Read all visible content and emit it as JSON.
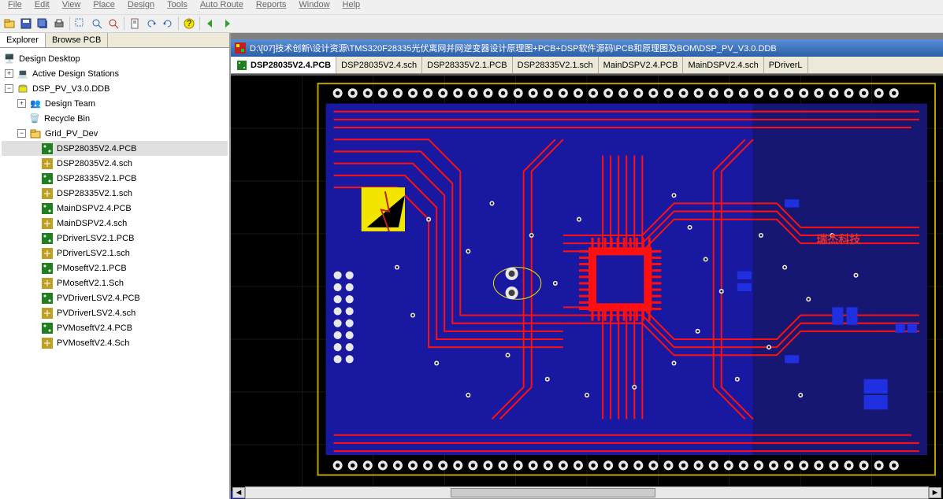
{
  "menu": {
    "items": [
      "File",
      "Edit",
      "View",
      "Place",
      "Design",
      "Tools",
      "Auto Route",
      "Reports",
      "Window",
      "Help"
    ]
  },
  "toolbar": {
    "icons": [
      "new-icon",
      "open-icon",
      "save-icon",
      "print-icon",
      "preview-icon",
      "zoom-in-icon",
      "zoom-out-icon",
      "fit-icon",
      "book-icon",
      "undo-icon",
      "redo-icon",
      "question-icon",
      "hand-icon",
      "arrow-icon"
    ]
  },
  "sidebarTabs": {
    "explorer": "Explorer",
    "browse": "Browse PCB"
  },
  "tree": {
    "root": "Design Desktop",
    "stations": "Active Design Stations",
    "ddb": "DSP_PV_V3.0.DDB",
    "designTeam": "Design Team",
    "recycle": "Recycle Bin",
    "folder": "Grid_PV_Dev",
    "files": [
      "DSP28035V2.4.PCB",
      "DSP28035V2.4.sch",
      "DSP28335V2.1.PCB",
      "DSP28335V2.1.sch",
      "MainDSPV2.4.PCB",
      "MainDSPV2.4.sch",
      "PDriverLSV2.1.PCB",
      "PDriverLSV2.1.sch",
      "PMoseftV2.1.PCB",
      "PMoseftV2.1.Sch",
      "PVDriverLSV2.4.PCB",
      "PVDriverLSV2.4.sch",
      "PVMoseftV2.4.PCB",
      "PVMoseftV2.4.Sch"
    ]
  },
  "doc": {
    "title": "D:\\[07]技术创新\\设计资源\\TMS320F28335光伏离网并网逆变器设计原理图+PCB+DSP软件源码\\PCB和原理图及BOM\\DSP_PV_V3.0.DDB",
    "tabs": [
      "DSP28035V2.4.PCB",
      "DSP28035V2.4.sch",
      "DSP28335V2.1.PCB",
      "DSP28335V2.1.sch",
      "MainDSPV2.4.PCB",
      "MainDSPV2.4.sch",
      "PDriverL"
    ]
  },
  "board": {
    "silkText": "瑞杰科技",
    "colors": {
      "trace": "#ff1010",
      "fill": "#1818a0",
      "via": "#e8e8e8",
      "outline": "#c0a000",
      "esd": "#f2e600"
    }
  }
}
